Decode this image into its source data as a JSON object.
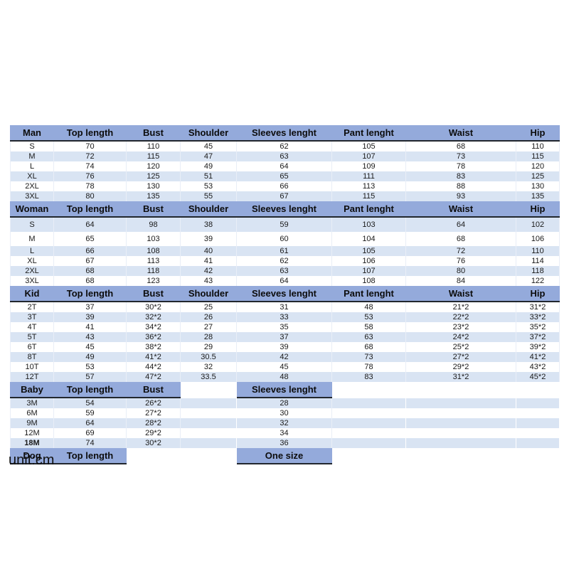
{
  "unit_note": "unit:cm",
  "columns": [
    "Top length",
    "Bust",
    "Shoulder",
    "Sleeves lenght",
    "Pant lenght",
    "Waist",
    "Hip"
  ],
  "sections": [
    {
      "name": "Man",
      "headers": [
        "Man",
        "Top length",
        "Bust",
        "Shoulder",
        "Sleeves lenght",
        "Pant lenght",
        "Waist",
        "Hip"
      ],
      "rows": [
        {
          "size": "S",
          "top_length": "70",
          "bust": "110",
          "shoulder": "45",
          "sleeves": "62",
          "pant": "105",
          "waist": "68",
          "hip": "110"
        },
        {
          "size": "M",
          "top_length": "72",
          "bust": "115",
          "shoulder": "47",
          "sleeves": "63",
          "pant": "107",
          "waist": "73",
          "hip": "115"
        },
        {
          "size": "L",
          "top_length": "74",
          "bust": "120",
          "shoulder": "49",
          "sleeves": "64",
          "pant": "109",
          "waist": "78",
          "hip": "120"
        },
        {
          "size": "XL",
          "top_length": "76",
          "bust": "125",
          "shoulder": "51",
          "sleeves": "65",
          "pant": "111",
          "waist": "83",
          "hip": "125"
        },
        {
          "size": "2XL",
          "top_length": "78",
          "bust": "130",
          "shoulder": "53",
          "sleeves": "66",
          "pant": "113",
          "waist": "88",
          "hip": "130"
        },
        {
          "size": "3XL",
          "top_length": "80",
          "bust": "135",
          "shoulder": "55",
          "sleeves": "67",
          "pant": "115",
          "waist": "93",
          "hip": "135"
        }
      ]
    },
    {
      "name": "Woman",
      "headers": [
        "Woman",
        "Top length",
        "Bust",
        "Shoulder",
        "Sleeves lenght",
        "Pant lenght",
        "Waist",
        "Hip"
      ],
      "rows": [
        {
          "size": "S",
          "top_length": "64",
          "bust": "98",
          "shoulder": "38",
          "sleeves": "59",
          "pant": "103",
          "waist": "64",
          "hip": "102"
        },
        {
          "size": "M",
          "top_length": "65",
          "bust": "103",
          "shoulder": "39",
          "sleeves": "60",
          "pant": "104",
          "waist": "68",
          "hip": "106"
        },
        {
          "size": "L",
          "top_length": "66",
          "bust": "108",
          "shoulder": "40",
          "sleeves": "61",
          "pant": "105",
          "waist": "72",
          "hip": "110"
        },
        {
          "size": "XL",
          "top_length": "67",
          "bust": "113",
          "shoulder": "41",
          "sleeves": "62",
          "pant": "106",
          "waist": "76",
          "hip": "114"
        },
        {
          "size": "2XL",
          "top_length": "68",
          "bust": "118",
          "shoulder": "42",
          "sleeves": "63",
          "pant": "107",
          "waist": "80",
          "hip": "118"
        },
        {
          "size": "3XL",
          "top_length": "68",
          "bust": "123",
          "shoulder": "43",
          "sleeves": "64",
          "pant": "108",
          "waist": "84",
          "hip": "122"
        }
      ]
    },
    {
      "name": "Kid",
      "headers": [
        "Kid",
        "Top length",
        "Bust",
        "Shoulder",
        "Sleeves lenght",
        "Pant lenght",
        "Waist",
        "Hip"
      ],
      "rows": [
        {
          "size": "2T",
          "top_length": "37",
          "bust": "30*2",
          "shoulder": "25",
          "sleeves": "31",
          "pant": "48",
          "waist": "21*2",
          "hip": "31*2"
        },
        {
          "size": "3T",
          "top_length": "39",
          "bust": "32*2",
          "shoulder": "26",
          "sleeves": "33",
          "pant": "53",
          "waist": "22*2",
          "hip": "33*2"
        },
        {
          "size": "4T",
          "top_length": "41",
          "bust": "34*2",
          "shoulder": "27",
          "sleeves": "35",
          "pant": "58",
          "waist": "23*2",
          "hip": "35*2"
        },
        {
          "size": "5T",
          "top_length": "43",
          "bust": "36*2",
          "shoulder": "28",
          "sleeves": "37",
          "pant": "63",
          "waist": "24*2",
          "hip": "37*2"
        },
        {
          "size": "6T",
          "top_length": "45",
          "bust": "38*2",
          "shoulder": "29",
          "sleeves": "39",
          "pant": "68",
          "waist": "25*2",
          "hip": "39*2"
        },
        {
          "size": "8T",
          "top_length": "49",
          "bust": "41*2",
          "shoulder": "30.5",
          "sleeves": "42",
          "pant": "73",
          "waist": "27*2",
          "hip": "41*2"
        },
        {
          "size": "10T",
          "top_length": "53",
          "bust": "44*2",
          "shoulder": "32",
          "sleeves": "45",
          "pant": "78",
          "waist": "29*2",
          "hip": "43*2"
        },
        {
          "size": "12T",
          "top_length": "57",
          "bust": "47*2",
          "shoulder": "33.5",
          "sleeves": "48",
          "pant": "83",
          "waist": "31*2",
          "hip": "45*2"
        }
      ]
    },
    {
      "name": "Baby",
      "headers": [
        "Baby",
        "Top length",
        "Bust",
        "",
        "Sleeves lenght",
        "",
        "",
        ""
      ],
      "rows": [
        {
          "size": "3M",
          "top_length": "54",
          "bust": "26*2",
          "shoulder": "",
          "sleeves": "28",
          "pant": "",
          "waist": "",
          "hip": ""
        },
        {
          "size": "6M",
          "top_length": "59",
          "bust": "27*2",
          "shoulder": "",
          "sleeves": "30",
          "pant": "",
          "waist": "",
          "hip": ""
        },
        {
          "size": "9M",
          "top_length": "64",
          "bust": "28*2",
          "shoulder": "",
          "sleeves": "32",
          "pant": "",
          "waist": "",
          "hip": ""
        },
        {
          "size": "12M",
          "top_length": "69",
          "bust": "29*2",
          "shoulder": "",
          "sleeves": "34",
          "pant": "",
          "waist": "",
          "hip": ""
        },
        {
          "size": "18M",
          "top_length": "74",
          "bust": "30*2",
          "shoulder": "",
          "sleeves": "36",
          "pant": "",
          "waist": "",
          "hip": ""
        }
      ]
    },
    {
      "name": "Dog",
      "headers": [
        "Dog",
        "Top length",
        "",
        "",
        "One size",
        "",
        "",
        ""
      ],
      "rows": []
    }
  ]
}
